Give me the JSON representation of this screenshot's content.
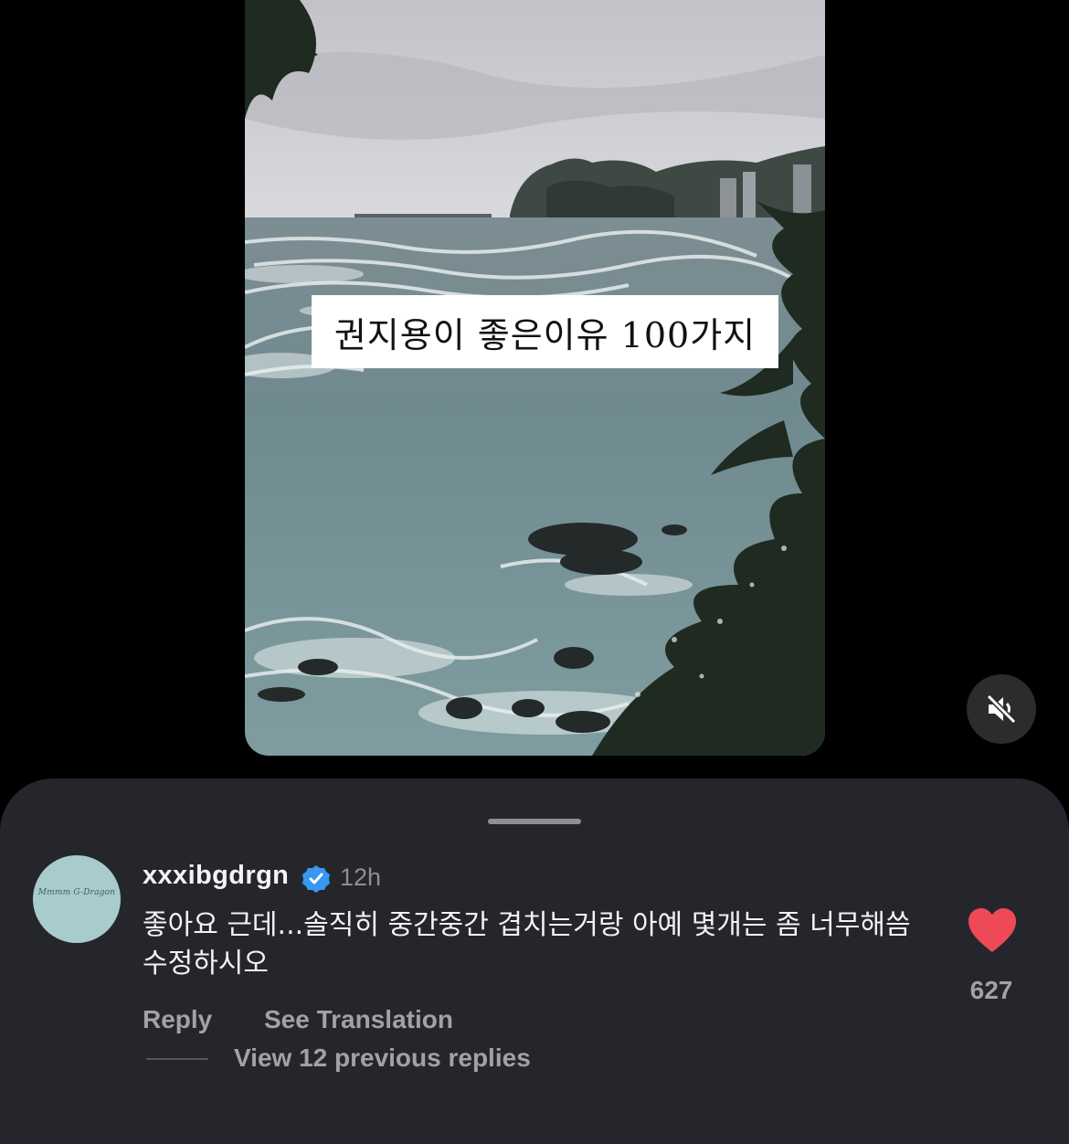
{
  "video": {
    "caption": "권지용이 좋은이유 100가지",
    "mute_icon": "speaker-muted-icon"
  },
  "comment": {
    "avatar_text": "Mmmm G-Dragon",
    "username": "xxxibgdrgn",
    "verified_icon": "verified-badge-icon",
    "time": "12h",
    "text": "좋아요 근데...솔직히 중간중간 겹치는거랑 아예 몇개는 좀 너무해씀 수정하시오",
    "like_icon": "heart-icon",
    "like_color": "#ed4956",
    "likes": "627",
    "reply_label": "Reply",
    "translate_label": "See Translation",
    "view_replies_label": "View 12 previous replies"
  }
}
